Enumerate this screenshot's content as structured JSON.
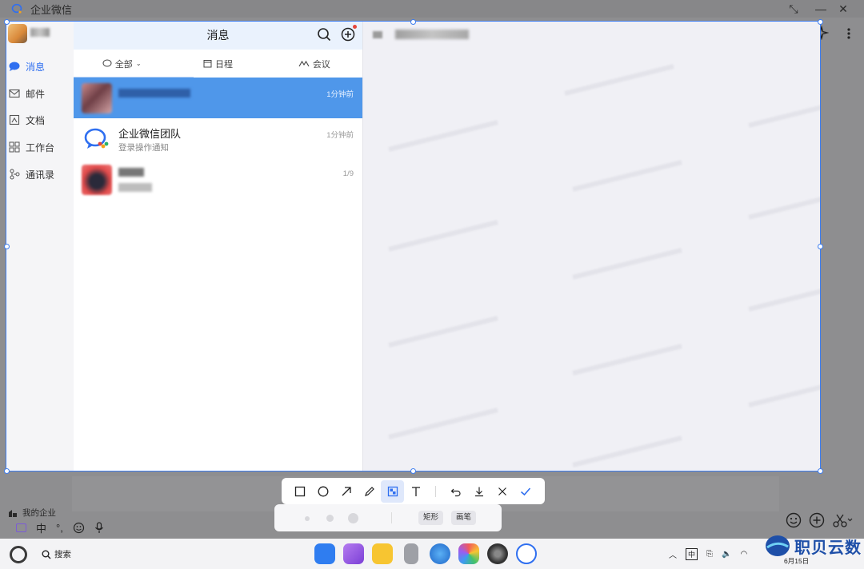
{
  "window": {
    "title": "企业微信"
  },
  "nav": {
    "items": [
      {
        "label": "消息",
        "active": true
      },
      {
        "label": "邮件",
        "active": false
      },
      {
        "label": "文档",
        "active": false
      },
      {
        "label": "工作台",
        "active": false
      },
      {
        "label": "通讯录",
        "active": false
      }
    ]
  },
  "list": {
    "title": "消息",
    "filters": [
      "全部",
      "日程",
      "会议"
    ],
    "conversations": [
      {
        "name": "",
        "subtitle": "",
        "time": "1分钟前",
        "selected": true
      },
      {
        "name": "企业微信团队",
        "subtitle": "登录操作通知",
        "time": "1分钟前",
        "selected": false
      },
      {
        "name": "",
        "subtitle": "",
        "time": "1/9",
        "selected": false
      }
    ]
  },
  "screenshot_tools": {
    "tools": [
      "rectangle",
      "circle",
      "arrow",
      "pen",
      "mosaic",
      "text"
    ],
    "active_tool": "mosaic",
    "actions": [
      "undo",
      "download",
      "cancel",
      "confirm"
    ],
    "options": [
      "矩形",
      "画笔"
    ]
  },
  "footer": {
    "my_company": "我的企业",
    "ime_lang": "中",
    "ime_punct": "°,"
  },
  "taskbar": {
    "search": "搜索",
    "tray_ime": "中",
    "date": "6月15日"
  },
  "watermark_brand": "职贝云数",
  "colors": {
    "accent": "#3d7df0",
    "selected_row": "#4f97ea",
    "header_bg": "#eaf2fd"
  }
}
